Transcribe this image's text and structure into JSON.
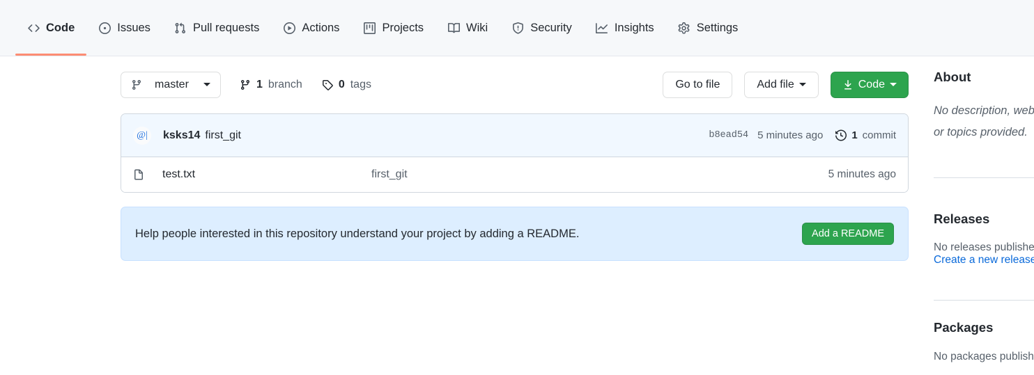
{
  "nav": {
    "tabs": [
      {
        "label": "Code",
        "icon": "code-icon",
        "active": true
      },
      {
        "label": "Issues",
        "icon": "issue-opened-icon",
        "active": false
      },
      {
        "label": "Pull requests",
        "icon": "git-pull-request-icon",
        "active": false
      },
      {
        "label": "Actions",
        "icon": "play-icon",
        "active": false
      },
      {
        "label": "Projects",
        "icon": "project-icon",
        "active": false
      },
      {
        "label": "Wiki",
        "icon": "book-icon",
        "active": false
      },
      {
        "label": "Security",
        "icon": "shield-icon",
        "active": false
      },
      {
        "label": "Insights",
        "icon": "graph-icon",
        "active": false
      },
      {
        "label": "Settings",
        "icon": "gear-icon",
        "active": false
      }
    ]
  },
  "toolbar": {
    "branch_name": "master",
    "branch_icon": "git-branch-icon",
    "branches_count": "1",
    "branches_label": "branch",
    "tags_count": "0",
    "tags_label": "tags",
    "tag_icon": "tag-icon",
    "go_to_file_label": "Go to file",
    "add_file_label": "Add file",
    "code_label": "Code",
    "code_icon": "download-icon",
    "code_button_color": "#2da44e"
  },
  "file_list": {
    "commit": {
      "avatar_text": "@|",
      "author": "ksks14",
      "message": "first_git",
      "sha": "b8ead54",
      "relative_time": "5 minutes ago",
      "history_icon": "history-icon",
      "commits_count": "1",
      "commits_label": "commit"
    },
    "columns": [
      "name",
      "message",
      "time"
    ],
    "rows": [
      {
        "icon": "file-icon",
        "name": "test.txt",
        "message": "first_git",
        "time": "5 minutes ago"
      }
    ]
  },
  "readme_callout": {
    "text": "Help people interested in this repository understand your project by adding a README.",
    "button_label": "Add a README",
    "background_color": "#ddeeff",
    "button_color": "#2da44e"
  },
  "sidebar": {
    "about": {
      "title": "About",
      "description": "No description, website, or topics provided."
    },
    "releases": {
      "title": "Releases",
      "empty_text": "No releases published",
      "create_link": "Create a new release"
    },
    "packages": {
      "title": "Packages",
      "empty_text": "No packages published"
    }
  }
}
